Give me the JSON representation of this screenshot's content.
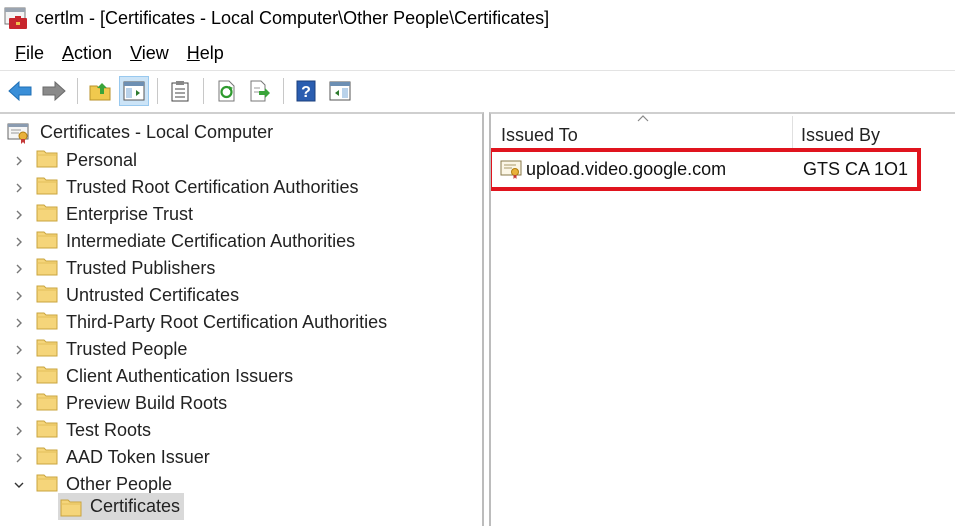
{
  "window": {
    "title": "certlm - [Certificates - Local Computer\\Other People\\Certificates]"
  },
  "menu": {
    "items": [
      {
        "accel": "F",
        "rest": "ile"
      },
      {
        "accel": "A",
        "rest": "ction"
      },
      {
        "accel": "V",
        "rest": "iew"
      },
      {
        "accel": "H",
        "rest": "elp"
      }
    ]
  },
  "toolbar": {
    "buttons": [
      "back-icon",
      "forward-icon",
      "up-folder-icon",
      "show-hide-tree-icon",
      "properties-icon",
      "refresh-icon",
      "export-list-icon",
      "help-icon",
      "show-action-pane-icon"
    ]
  },
  "tree": {
    "root_label": "Certificates - Local Computer",
    "items": [
      {
        "label": "Personal",
        "expanded": false
      },
      {
        "label": "Trusted Root Certification Authorities",
        "expanded": false
      },
      {
        "label": "Enterprise Trust",
        "expanded": false
      },
      {
        "label": "Intermediate Certification Authorities",
        "expanded": false
      },
      {
        "label": "Trusted Publishers",
        "expanded": false
      },
      {
        "label": "Untrusted Certificates",
        "expanded": false
      },
      {
        "label": "Third-Party Root Certification Authorities",
        "expanded": false
      },
      {
        "label": "Trusted People",
        "expanded": false
      },
      {
        "label": "Client Authentication Issuers",
        "expanded": false
      },
      {
        "label": "Preview Build Roots",
        "expanded": false
      },
      {
        "label": "Test Roots",
        "expanded": false
      },
      {
        "label": "AAD Token Issuer",
        "expanded": false
      },
      {
        "label": "Other People",
        "expanded": true
      }
    ],
    "selected_child": "Certificates"
  },
  "list": {
    "columns": [
      "Issued To",
      "Issued By"
    ],
    "rows": [
      {
        "issued_to": "upload.video.google.com",
        "issued_by": "GTS CA 1O1"
      }
    ]
  },
  "colors": {
    "highlight": "#e0141e",
    "selection": "#d9d9d9",
    "folder": "#f5d57a"
  }
}
